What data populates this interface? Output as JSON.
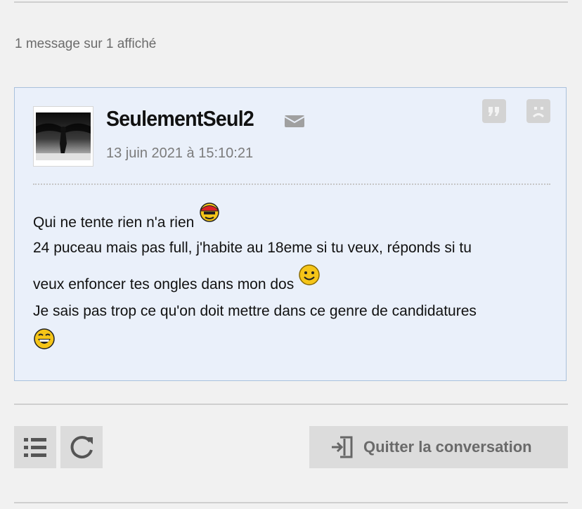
{
  "thread": {
    "count_text": "1 message sur 1 affiché"
  },
  "message": {
    "author": "SeulementSeul2",
    "date": "13 juin 2021 à 15:10:21",
    "lines": [
      "Qui ne tente rien n'a rien",
      "24 puceau mais pas full, j'habite au 18eme si tu veux, réponds si tu",
      "veux enfoncer tes ongles dans mon dos",
      "Je sais pas trop ce qu'on doit mettre dans ce genre de candidatures"
    ],
    "icons": {
      "mail": "envelope-icon",
      "quote": "quote-icon",
      "report": "sad-face-icon",
      "smiley_1": "cap-smiley-icon",
      "smiley_2": "smile-icon",
      "smiley_3": "laugh-icon"
    }
  },
  "footer": {
    "list_icon": "list-icon",
    "refresh_icon": "refresh-icon",
    "quit_icon": "exit-icon",
    "quit_label": "Quitter la conversation"
  },
  "colors": {
    "card_bg": "#eaf0fa",
    "card_border": "#a9c1dc",
    "page_bg": "#f1f1f1",
    "button_bg": "#dcdcdc"
  }
}
